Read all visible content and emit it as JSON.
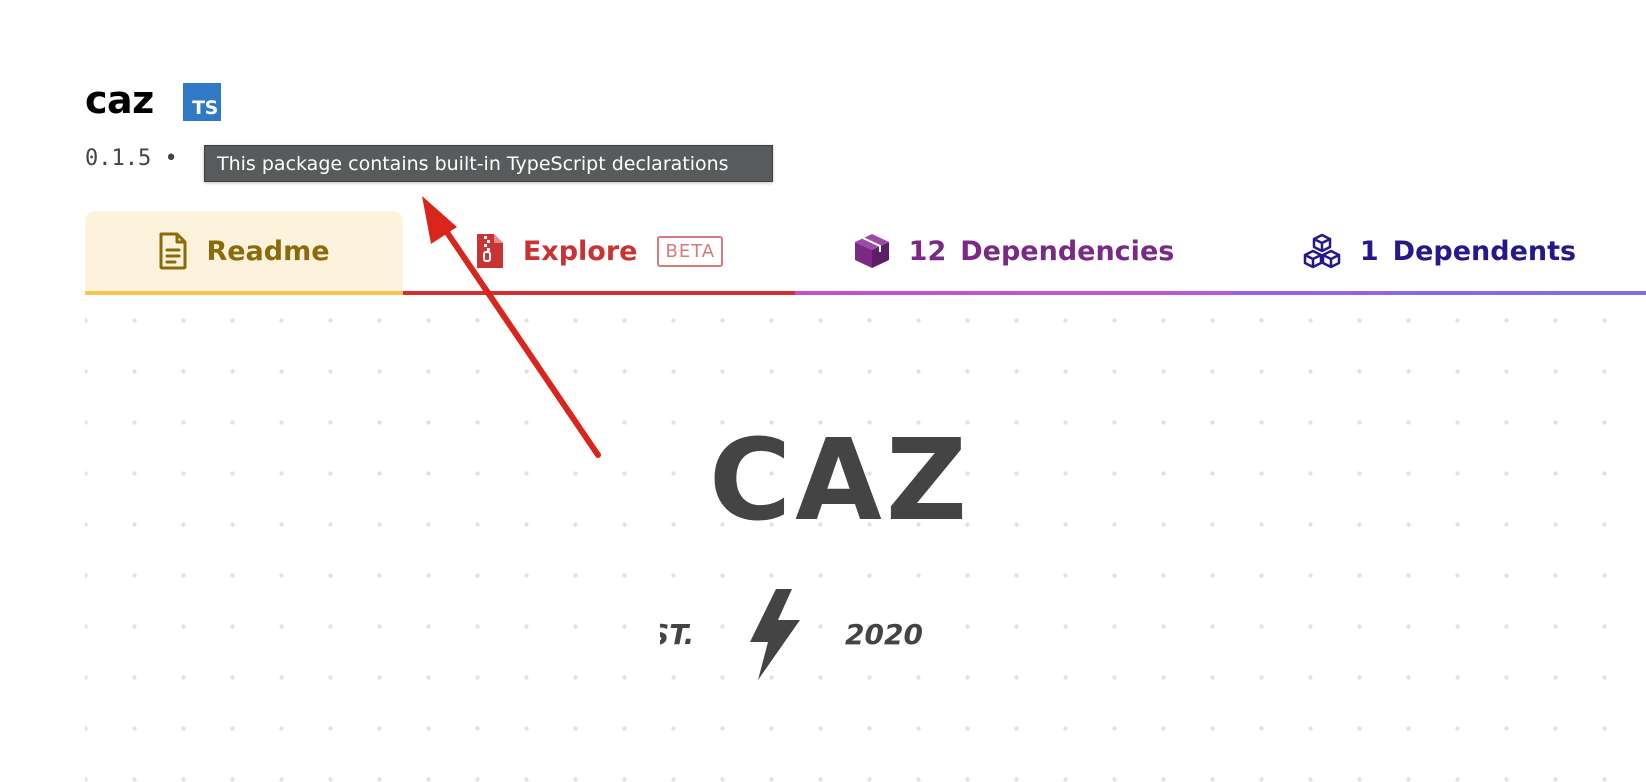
{
  "package": {
    "name": "caz",
    "ts_badge": "TS",
    "version": "0.1.5 •"
  },
  "tooltip": {
    "text": "This package contains built-in TypeScript declarations"
  },
  "tabs": {
    "readme": {
      "label": "Readme",
      "icon": "document-icon",
      "color": "#8a6a0a",
      "active": true
    },
    "explore": {
      "label": "Explore",
      "badge": "BETA",
      "icon": "zip-file-icon",
      "color": "#c83434"
    },
    "dependencies": {
      "count": "12",
      "label": "Dependencies",
      "icon": "box-icon",
      "color": "#7a2a84"
    },
    "dependents": {
      "count": "1",
      "label": "Dependents",
      "icon": "boxes-icon",
      "color": "#24188c"
    }
  },
  "readme_logo": {
    "title": "CAZ",
    "est": "EST.",
    "year": "2020",
    "icon": "lightning-bolt-icon"
  },
  "annotation": {
    "arrow_color": "#d9261c",
    "icon": "annotation-arrow-icon"
  }
}
